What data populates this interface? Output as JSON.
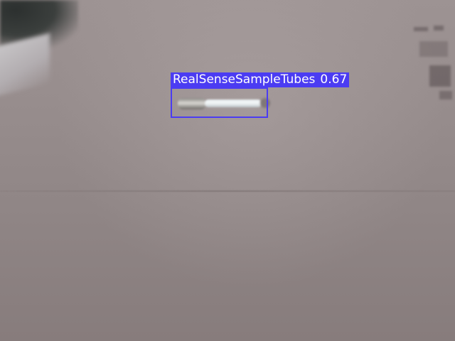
{
  "detection": {
    "label": "RealSenseSampleTubes",
    "confidence": "0.67",
    "box_color": "#4b3cf2"
  },
  "scene": {
    "surface": "cardboard",
    "object": "sample-tube"
  }
}
